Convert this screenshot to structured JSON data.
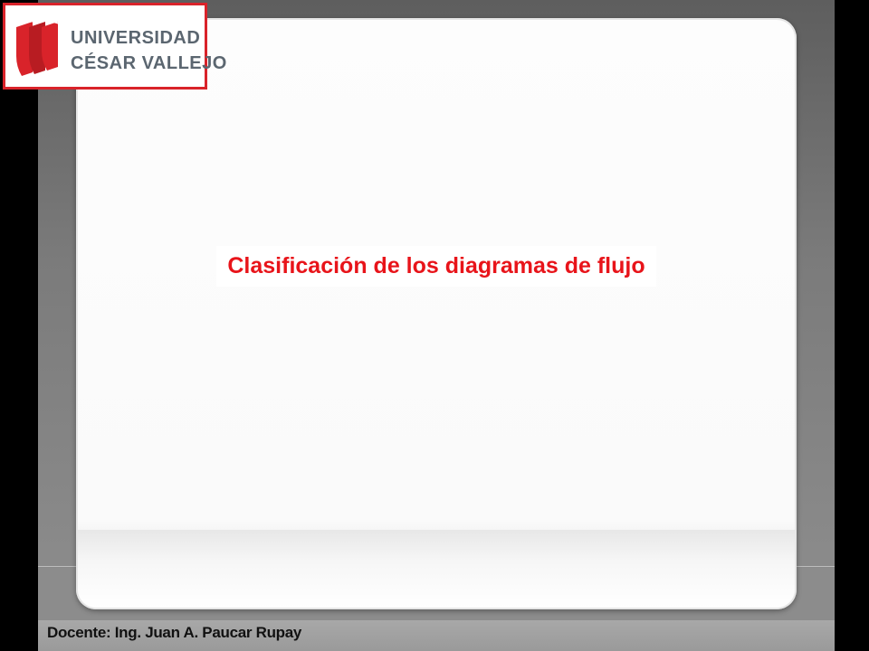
{
  "logo": {
    "line1": "UNIVERSIDAD",
    "line2": "CÉSAR VALLEJO",
    "icon": "university-crest-icon"
  },
  "slide": {
    "title": "Clasificación de los diagramas de flujo"
  },
  "footer": {
    "instructor": "Docente: Ing. Juan A. Paucar Rupay"
  },
  "colors": {
    "title": "#e8141a",
    "logo_border": "#d9232a",
    "logo_text": "#5b6670"
  }
}
